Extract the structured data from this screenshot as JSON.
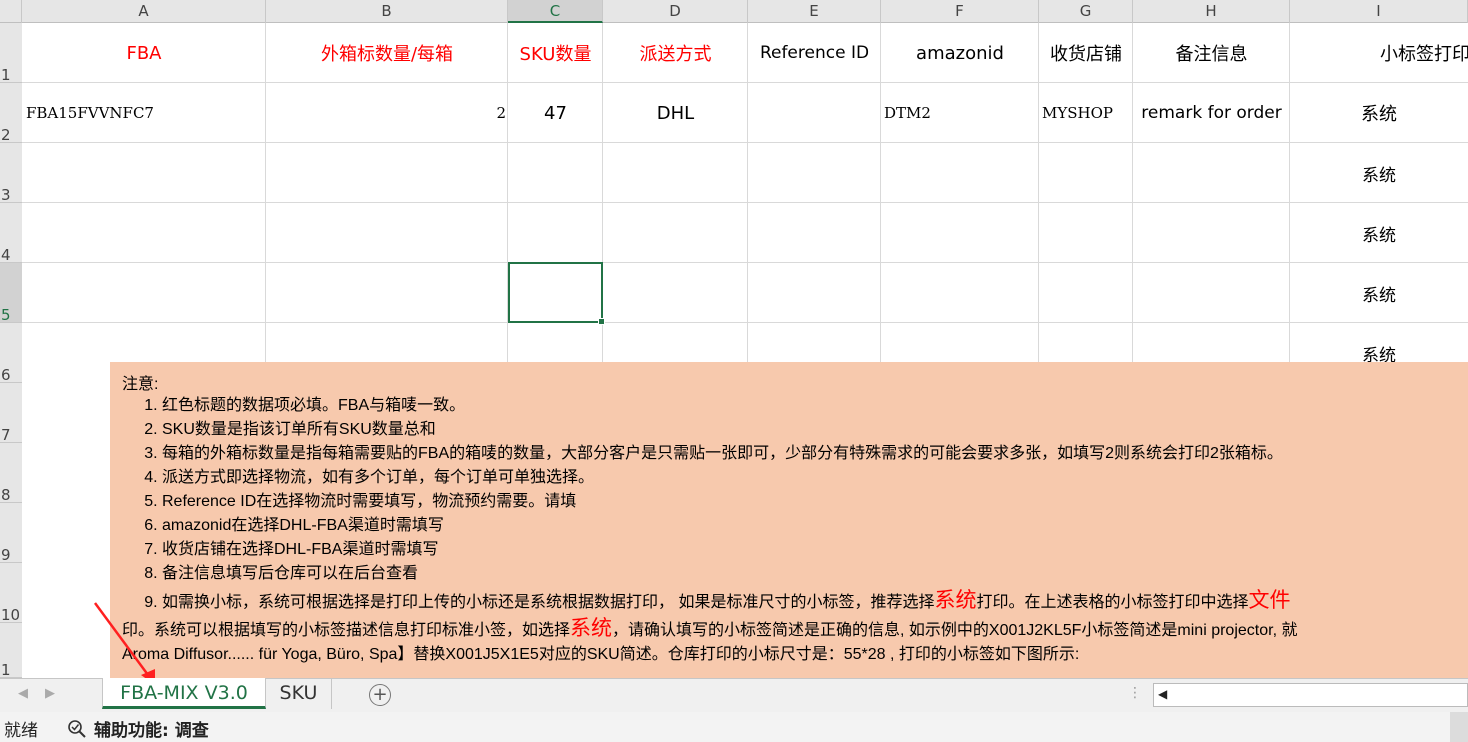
{
  "columns": [
    "A",
    "B",
    "C",
    "D",
    "E",
    "F",
    "G",
    "H",
    "I"
  ],
  "rows": [
    "1",
    "2",
    "3",
    "4",
    "5",
    "6",
    "7",
    "8",
    "9",
    "10",
    "1"
  ],
  "header_row": {
    "a": "FBA",
    "b": "外箱标数量/每箱",
    "c": "SKU数量",
    "d": "派送方式",
    "e": "Reference ID",
    "f": "amazonid",
    "g": "收货店铺",
    "h": "备注信息",
    "i": "小标签打印"
  },
  "data_row": {
    "a": "FBA15FVVNFC7",
    "b": "2",
    "c": "47",
    "d": "DHL",
    "e": "",
    "f": "DTM2",
    "g": "MYSHOP",
    "h": "remark for order",
    "i": "系统"
  },
  "col_i_values": [
    "系统",
    "系统",
    "系统",
    "系统"
  ],
  "note": {
    "title": "注意:",
    "items": [
      "红色标题的数据项必填。FBA与箱唛一致。",
      "SKU数量是指该订单所有SKU数量总和",
      "每箱的外箱标数量是指每箱需要贴的FBA的箱唛的数量，大部分客户是只需贴一张即可，少部分有特殊需求的可能会要求多张，如填写2则系统会打印2张箱标。",
      "派送方式即选择物流，如有多个订单，每个订单可单独选择。",
      "Reference ID在选择物流时需要填写，物流预约需要。请填",
      "amazonid在选择DHL-FBA渠道时需填写",
      "收货店铺在选择DHL-FBA渠道时需填写",
      "备注信息填写后仓库可以在后台查看"
    ],
    "item9_part1": "如需换小标，系统可根据选择是打印上传的小标还是系统根据数据打印， 如果是标准尺寸的小标签，推荐选择",
    "item9_highlight": "系统",
    "item9_part2": "打印。在上述表格的小标签打印中选择",
    "item9_highlight2": "文件",
    "cont1_part1": "印。系统可以根据填写的小标签描述信息打印标准小签，如选择",
    "cont1_highlight": "系统",
    "cont1_part2": "，请确认填写的小标签简述是正确的信息, 如示例中的X001J2KL5F小标签简述是mini projector, 就",
    "cont2": "Aroma Diffusor...... für Yoga, Büro, Spa】替换X001J5X1E5对应的SKU简述。仓库打印的小标尺寸是：55*28 , 打印的小标签如下图所示:"
  },
  "tabs": {
    "active": "FBA-MIX V3.0",
    "second": "SKU",
    "add": "+"
  },
  "status": {
    "ready": "就绪",
    "accessibility": "辅助功能: 调查"
  },
  "colors": {
    "accent": "#217346",
    "required_header": "#ff0000",
    "note_bg": "#f7c9ad"
  }
}
